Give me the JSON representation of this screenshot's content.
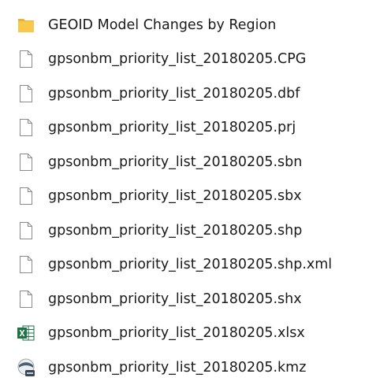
{
  "file_list": {
    "items": [
      {
        "name": "GEOID Model Changes by Region",
        "icon": "folder-icon"
      },
      {
        "name": "gpsonbm_priority_list_20180205.CPG",
        "icon": "file-icon"
      },
      {
        "name": "gpsonbm_priority_list_20180205.dbf",
        "icon": "file-icon"
      },
      {
        "name": "gpsonbm_priority_list_20180205.prj",
        "icon": "file-icon"
      },
      {
        "name": "gpsonbm_priority_list_20180205.sbn",
        "icon": "file-icon"
      },
      {
        "name": "gpsonbm_priority_list_20180205.sbx",
        "icon": "file-icon"
      },
      {
        "name": "gpsonbm_priority_list_20180205.shp",
        "icon": "file-icon"
      },
      {
        "name": "gpsonbm_priority_list_20180205.shp.xml",
        "icon": "file-icon"
      },
      {
        "name": "gpsonbm_priority_list_20180205.shx",
        "icon": "file-icon"
      },
      {
        "name": "gpsonbm_priority_list_20180205.xlsx",
        "icon": "excel-icon"
      },
      {
        "name": "gpsonbm_priority_list_20180205.kmz",
        "icon": "google-earth-icon"
      }
    ]
  },
  "colors": {
    "folder": "#f7c84a",
    "excel": "#1f7244",
    "earth": "#4d5f6e"
  }
}
